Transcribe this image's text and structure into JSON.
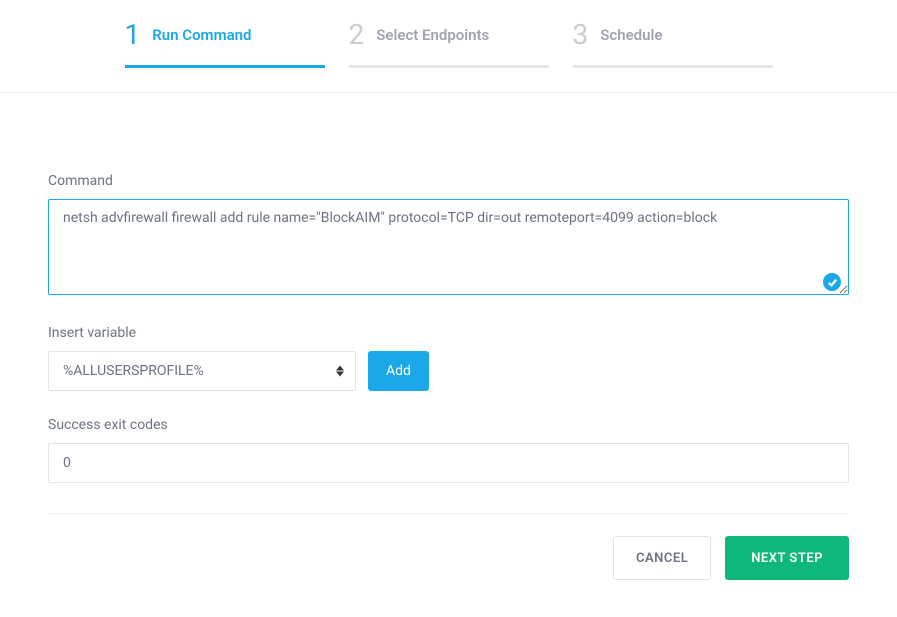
{
  "wizard": {
    "steps": [
      {
        "number": "1",
        "label": "Run Command",
        "active": true
      },
      {
        "number": "2",
        "label": "Select Endpoints",
        "active": false
      },
      {
        "number": "3",
        "label": "Schedule",
        "active": false
      }
    ]
  },
  "form": {
    "command": {
      "label": "Command",
      "value": "netsh advfirewall firewall add rule name=\"BlockAIM\" protocol=TCP dir=out remoteport=4099 action=block"
    },
    "insertVariable": {
      "label": "Insert variable",
      "selected": "%ALLUSERSPROFILE%",
      "addLabel": "Add"
    },
    "exitCodes": {
      "label": "Success exit codes",
      "value": "0"
    }
  },
  "footer": {
    "cancelLabel": "CANCEL",
    "nextLabel": "NEXT STEP"
  },
  "colors": {
    "primary": "#1aa8e8",
    "success": "#0fb87a",
    "border": "#e1e4e8",
    "text": "#6c7480"
  }
}
